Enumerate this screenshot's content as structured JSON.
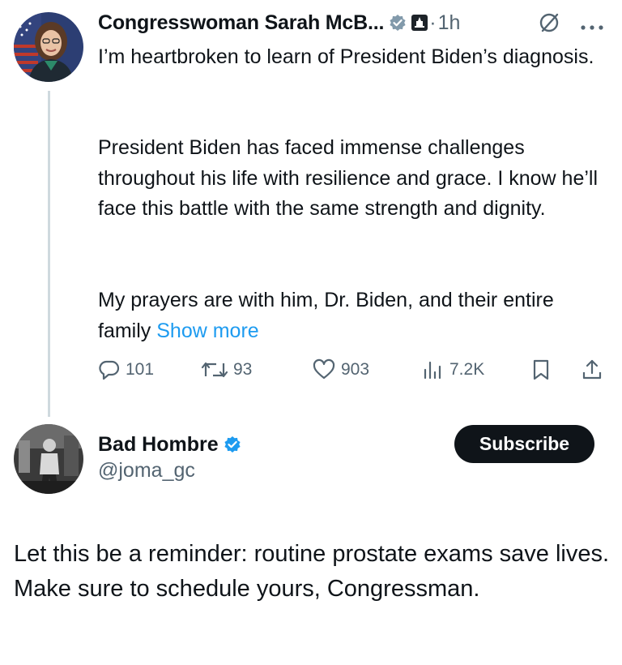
{
  "tweet1": {
    "author_name": "Congresswoman Sarah McB...",
    "time_sep": "·",
    "time": "1h",
    "paragraphs": [
      "I’m heartbroken to learn of President Biden’s diagnosis.",
      "President Biden has faced immense challenges throughout his life with resilience and grace. I know he’ll face this battle with the same strength and dignity.",
      "My prayers are with him, Dr. Biden, and their entire family"
    ],
    "show_more": "Show more",
    "actions": {
      "replies": "101",
      "retweets": "93",
      "likes": "903",
      "views": "7.2K"
    }
  },
  "tweet2": {
    "author_name": "Bad Hombre",
    "handle": "@joma_gc",
    "subscribe_label": "Subscribe",
    "text": "Let this be a reminder: routine prostate exams save lives. Make sure to schedule yours, Congressman."
  },
  "colors": {
    "text": "#0f1419",
    "secondary": "#536471",
    "link": "#1d9bf0",
    "verified": "#1d9bf0",
    "thread_line": "#cfd9de"
  },
  "icons": [
    "verified-badge-icon",
    "government-badge-icon",
    "no-sign-icon",
    "more-icon",
    "reply-icon",
    "retweet-icon",
    "like-icon",
    "views-icon",
    "bookmark-icon",
    "share-icon"
  ]
}
